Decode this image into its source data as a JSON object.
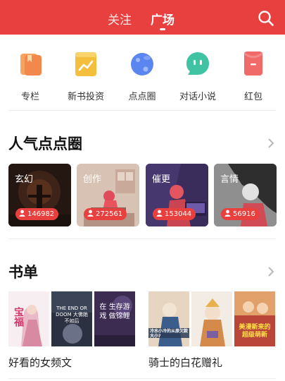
{
  "header": {
    "tabs": [
      {
        "label": "关注",
        "active": false
      },
      {
        "label": "广场",
        "active": true
      }
    ],
    "bar_color": "#e8403f",
    "search_icon": "search-icon"
  },
  "quick_entries": [
    {
      "label": "专栏",
      "icon": "column-icon",
      "color": "#f3884d"
    },
    {
      "label": "新书投资",
      "icon": "trend-chart-icon",
      "color": "#f5bf3e"
    },
    {
      "label": "点点圈",
      "icon": "planet-icon",
      "color": "#5b86f0"
    },
    {
      "label": "对话小说",
      "icon": "chat-bubble-icon",
      "color": "#3fc3a3"
    },
    {
      "label": "红包",
      "icon": "red-envelope-icon",
      "color": "#f06a6a"
    }
  ],
  "popular_circles": {
    "title": "人气点点圈",
    "items": [
      {
        "name": "玄幻",
        "count": "146982"
      },
      {
        "name": "创作",
        "count": "272561"
      },
      {
        "name": "催更",
        "count": "153044"
      },
      {
        "name": "言情",
        "count": "56916"
      }
    ]
  },
  "booklists": {
    "title": "书单",
    "items": [
      {
        "title": "好看的女频文",
        "covers": [
          {
            "text": "宝福"
          },
          {
            "text": "THE END OR DOOM 大佛她不如后"
          },
          {
            "text": "在 生存游戏 做锦鲤"
          }
        ]
      },
      {
        "title": "骑士的白花赠礼",
        "covers": [
          {
            "text": "冷水小冷的从原欠款大小?"
          },
          {
            "text": ""
          },
          {
            "text": "美漫新来的 超级萌新"
          }
        ]
      }
    ]
  }
}
